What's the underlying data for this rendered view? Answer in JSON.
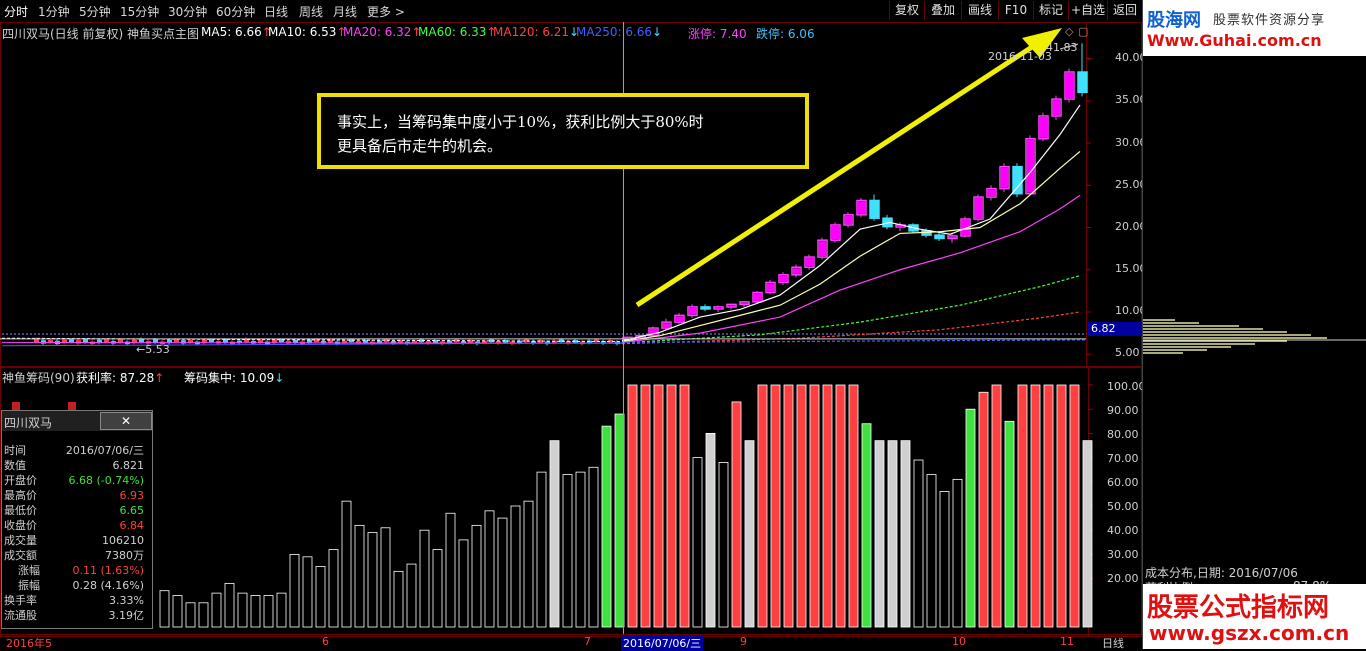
{
  "toolbar": {
    "timeframes": [
      "分时",
      "1分钟",
      "5分钟",
      "15分钟",
      "30分钟",
      "60分钟",
      "日线",
      "周线",
      "月线",
      "更多 >"
    ],
    "buttons": [
      "复权",
      "叠加",
      "画线",
      "F10",
      "标记",
      "+自选",
      "返回"
    ]
  },
  "main": {
    "stock_title": "四川双马(日线 前复权) 神鱼买点主图",
    "ma": [
      {
        "label": "MA5: 6.66",
        "arrow": "↑",
        "color": "#ffffff"
      },
      {
        "label": "MA10: 6.53",
        "arrow": "↑",
        "color": "#ffffff"
      },
      {
        "label": "MA20: 6.32",
        "arrow": "↑",
        "color": "#ff40ff"
      },
      {
        "label": "MA60: 6.33",
        "arrow": "↑",
        "color": "#40ff40"
      },
      {
        "label": "MA120: 6.21",
        "arrow": "↓",
        "color": "#ff4040"
      },
      {
        "label": "MA250: 6.66",
        "arrow": "↓",
        "color": "#4060ff"
      }
    ],
    "limit_up": "涨停: 7.40",
    "limit_down": "跌停: 6.06",
    "price_axis": [
      "40.00",
      "35.00",
      "30.00",
      "25.00",
      "20.00",
      "15.00",
      "10.00",
      "5.00"
    ],
    "current_price_tag": "6.82",
    "high_label": "2016-11-03",
    "high_value": "41.83",
    "low_label": "5.53",
    "annotation": [
      "事实上，当筹码集中度小于10%，获利比例大于80%时",
      "更具备后市走牛的机会。"
    ]
  },
  "indicator": {
    "title": "神鱼筹码(90)",
    "profit_label": "获利率: 87.28",
    "profit_arrow": "↑",
    "conc_label": "筹码集中: 10.09",
    "conc_arrow": "↓",
    "axis": [
      "100.00",
      "90.00",
      "80.00",
      "70.00",
      "60.00",
      "50.00",
      "40.00",
      "30.00",
      "20.00"
    ]
  },
  "popup": {
    "title": "四川双马",
    "close": "✕",
    "rows": [
      {
        "label": "时间",
        "value": "2016/07/06/三",
        "color": "#d0d0d0"
      },
      {
        "label": "数值",
        "value": "6.821",
        "color": "#d0d0d0"
      },
      {
        "label": "开盘价",
        "value": "6.68 (-0.74%)",
        "color": "#40e040"
      },
      {
        "label": "最高价",
        "value": "6.93",
        "color": "#ff4040"
      },
      {
        "label": "最低价",
        "value": "6.65",
        "color": "#40e040"
      },
      {
        "label": "收盘价",
        "value": "6.84",
        "color": "#ff4040"
      },
      {
        "label": "成交量",
        "value": "106210",
        "color": "#d0d0d0"
      },
      {
        "label": "成交额",
        "value": "7380万",
        "color": "#d0d0d0"
      },
      {
        "label": "涨幅",
        "value": "0.11 (1.63%)",
        "color": "#ff4040"
      },
      {
        "label": "振幅",
        "value": "0.28 (4.16%)",
        "color": "#d0d0d0"
      },
      {
        "label": "换手率",
        "value": "3.33%",
        "color": "#d0d0d0"
      },
      {
        "label": "流通股",
        "value": "3.19亿",
        "color": "#d0d0d0"
      }
    ]
  },
  "bottom_axis": {
    "labels": [
      "2016年5",
      "6",
      "7",
      "2016/07/06/三",
      "9",
      "10",
      "11"
    ],
    "period": "日线"
  },
  "right_panel": {
    "logo_main": "股海网",
    "logo_sub": "股票软件资源分享",
    "logo_url": "Www.Guhai.com.cn",
    "cost_title": "成本分布,日期: 2016/07/06",
    "profit_ratio": "获利比例:",
    "profit_value": "87.8%",
    "watermark_main": "股票公式指标网",
    "watermark_url": "www.gszx.com.cn"
  },
  "chart_data": {
    "type": "candlestick",
    "price_range": [
      4,
      43
    ],
    "candles": [
      [
        34,
        1,
        0.4
      ],
      [
        41,
        -1,
        0.4
      ],
      [
        48,
        1,
        0.3
      ],
      [
        55,
        -1,
        0.4
      ],
      [
        62,
        1,
        0.4
      ],
      [
        69,
        -1,
        0.3
      ],
      [
        76,
        1,
        0.4
      ],
      [
        83,
        -1,
        0.4
      ],
      [
        90,
        1,
        0.3
      ],
      [
        97,
        -1,
        0.4
      ],
      [
        104,
        1,
        0.3
      ],
      [
        111,
        -1,
        0.3
      ],
      [
        118,
        1,
        0.4
      ],
      [
        125,
        -1,
        0.3
      ],
      [
        132,
        1,
        0.4
      ],
      [
        139,
        -1,
        0.4
      ],
      [
        146,
        1,
        0.3
      ],
      [
        153,
        -1,
        0.4
      ],
      [
        160,
        1,
        0.3
      ],
      [
        167,
        -1,
        0.4
      ],
      [
        174,
        1,
        0.3
      ],
      [
        181,
        -1,
        0.4
      ],
      [
        188,
        1,
        0.3
      ],
      [
        195,
        -1,
        0.3
      ],
      [
        202,
        1,
        0.4
      ],
      [
        209,
        -1,
        0.3
      ],
      [
        216,
        1,
        0.3
      ],
      [
        223,
        -1,
        0.4
      ],
      [
        230,
        1,
        0.3
      ],
      [
        237,
        -1,
        0.3
      ],
      [
        244,
        1,
        0.4
      ],
      [
        251,
        -1,
        0.3
      ],
      [
        258,
        1,
        0.3
      ],
      [
        265,
        -1,
        0.3
      ],
      [
        272,
        1,
        0.4
      ],
      [
        279,
        -1,
        0.3
      ],
      [
        286,
        1,
        0.3
      ],
      [
        293,
        -1,
        0.3
      ],
      [
        300,
        1,
        0.3
      ],
      [
        307,
        -1,
        0.4
      ],
      [
        314,
        1,
        0.3
      ],
      [
        321,
        -1,
        0.3
      ],
      [
        328,
        1,
        0.3
      ],
      [
        335,
        -1,
        0.3
      ],
      [
        342,
        1,
        0.3
      ],
      [
        349,
        -1,
        0.3
      ],
      [
        356,
        1,
        0.3
      ],
      [
        363,
        -1,
        0.3
      ],
      [
        370,
        1,
        0.3
      ],
      [
        377,
        -1,
        0.3
      ],
      [
        384,
        1,
        0.3
      ],
      [
        391,
        -1,
        0.3
      ],
      [
        398,
        1,
        0.3
      ],
      [
        405,
        -1,
        0.3
      ],
      [
        412,
        1,
        0.3
      ],
      [
        419,
        -1,
        0.3
      ],
      [
        426,
        1,
        0.3
      ],
      [
        433,
        -1,
        0.3
      ],
      [
        440,
        1,
        0.3
      ],
      [
        447,
        -1,
        0.3
      ],
      [
        454,
        1,
        0.3
      ],
      [
        461,
        -1,
        0.3
      ],
      [
        468,
        1,
        0.3
      ],
      [
        475,
        -1,
        0.3
      ],
      [
        482,
        1,
        0.3
      ],
      [
        489,
        -1,
        0.3
      ],
      [
        496,
        1,
        0.3
      ],
      [
        503,
        -1,
        0.3
      ],
      [
        510,
        1,
        0.3
      ],
      [
        517,
        -1,
        0.3
      ],
      [
        524,
        1,
        0.3
      ],
      [
        531,
        -1,
        0.3
      ],
      [
        538,
        1,
        0.3
      ],
      [
        545,
        -1,
        0.3
      ],
      [
        552,
        1,
        0.3
      ],
      [
        559,
        -1,
        0.3
      ],
      [
        566,
        1,
        0.3
      ],
      [
        573,
        -1,
        0.3
      ],
      [
        580,
        1,
        0.3
      ],
      [
        587,
        -1,
        0.3
      ],
      [
        594,
        1,
        0.3
      ],
      [
        601,
        -1,
        0.3
      ],
      [
        608,
        1,
        0.3
      ],
      [
        615,
        -1,
        0.3
      ]
    ],
    "series_main": [
      {
        "name": "MA5",
        "color": "#ffffff"
      },
      {
        "name": "MA10",
        "color": "#ffffb0"
      },
      {
        "name": "MA20",
        "color": "#ff40ff"
      },
      {
        "name": "MA60",
        "color": "#40ff40"
      },
      {
        "name": "MA120",
        "color": "#ff4040"
      },
      {
        "name": "MA250",
        "color": "#4060ff"
      }
    ],
    "rally": [
      [
        623,
        6.8,
        7.1,
        6.6,
        7.0
      ],
      [
        636,
        7.0,
        7.3,
        6.9,
        7.2
      ],
      [
        649,
        7.2,
        8.3,
        7.1,
        8.1
      ],
      [
        662,
        8.1,
        9.2,
        7.9,
        8.8
      ],
      [
        675,
        8.8,
        9.9,
        8.6,
        9.6
      ],
      [
        688,
        9.6,
        10.9,
        9.3,
        10.6
      ],
      [
        701,
        10.6,
        10.9,
        10.1,
        10.4
      ],
      [
        714,
        10.4,
        10.8,
        10.0,
        10.6
      ],
      [
        727,
        10.6,
        11.0,
        10.3,
        10.9
      ],
      [
        740,
        10.9,
        11.3,
        10.6,
        11.2
      ],
      [
        753,
        11.2,
        12.5,
        11.0,
        12.3
      ],
      [
        766,
        12.3,
        13.8,
        12.1,
        13.5
      ],
      [
        779,
        13.5,
        14.7,
        13.2,
        14.4
      ],
      [
        792,
        14.4,
        15.6,
        14.1,
        15.3
      ],
      [
        805,
        15.3,
        16.8,
        15.0,
        16.5
      ],
      [
        818,
        16.5,
        18.8,
        16.2,
        18.5
      ],
      [
        831,
        18.5,
        20.6,
        18.2,
        20.3
      ],
      [
        844,
        20.3,
        21.8,
        20.0,
        21.5
      ],
      [
        857,
        21.5,
        23.5,
        21.2,
        23.2
      ],
      [
        870,
        23.2,
        23.9,
        20.8,
        21.1
      ],
      [
        883,
        21.1,
        21.5,
        19.8,
        20.1
      ],
      [
        896,
        20.1,
        20.6,
        19.6,
        20.3
      ],
      [
        909,
        20.3,
        20.5,
        19.4,
        19.6
      ],
      [
        922,
        19.6,
        19.9,
        18.8,
        19.1
      ],
      [
        935,
        19.1,
        19.6,
        18.4,
        18.7
      ],
      [
        948,
        18.7,
        19.4,
        18.2,
        19.0
      ],
      [
        961,
        19.0,
        21.3,
        18.8,
        21.0
      ],
      [
        974,
        21.0,
        23.9,
        20.7,
        23.6
      ],
      [
        987,
        23.6,
        25.0,
        23.2,
        24.6
      ],
      [
        1000,
        24.6,
        27.6,
        24.2,
        27.2
      ],
      [
        1013,
        27.2,
        27.6,
        23.6,
        24.0
      ],
      [
        1026,
        24.0,
        30.9,
        23.8,
        30.5
      ],
      [
        1039,
        30.5,
        33.6,
        30.2,
        33.2
      ],
      [
        1052,
        33.2,
        35.6,
        32.7,
        35.2
      ],
      [
        1065,
        35.2,
        38.8,
        34.8,
        38.4
      ],
      [
        1078,
        38.4,
        41.8,
        35.5,
        36.0
      ]
    ],
    "indicator_bars": [
      [
        160,
        15,
        "#ffffff"
      ],
      [
        173,
        13,
        "#ffffff"
      ],
      [
        186,
        10,
        "#ffffff"
      ],
      [
        199,
        10,
        "#ffffff"
      ],
      [
        212,
        14,
        "#ffffff"
      ],
      [
        225,
        18,
        "#ffffff"
      ],
      [
        238,
        14,
        "#ffffff"
      ],
      [
        251,
        13,
        "#ffffff"
      ],
      [
        264,
        13,
        "#ffffff"
      ],
      [
        277,
        14,
        "#ffffff"
      ],
      [
        290,
        30,
        "#ffffff"
      ],
      [
        303,
        29,
        "#ffffff"
      ],
      [
        316,
        25,
        "#ffffff"
      ],
      [
        329,
        32,
        "#ffffff"
      ],
      [
        342,
        52,
        "#ffffff"
      ],
      [
        355,
        42,
        "#ffffff"
      ],
      [
        368,
        39,
        "#ffffff"
      ],
      [
        381,
        41,
        "#ffffff"
      ],
      [
        394,
        23,
        "#ffffff"
      ],
      [
        407,
        26,
        "#ffffff"
      ],
      [
        420,
        40,
        "#ffffff"
      ],
      [
        433,
        32,
        "#ffffff"
      ],
      [
        446,
        47,
        "#ffffff"
      ],
      [
        459,
        36,
        "#ffffff"
      ],
      [
        472,
        42,
        "#ffffff"
      ],
      [
        485,
        48,
        "#ffffff"
      ],
      [
        498,
        45,
        "#ffffff"
      ],
      [
        511,
        50,
        "#ffffff"
      ],
      [
        524,
        52,
        "#ffffff"
      ],
      [
        537,
        64,
        "#ffffff"
      ],
      [
        550,
        77,
        "#d0d0d0"
      ],
      [
        563,
        63,
        "#ffffff"
      ],
      [
        576,
        64,
        "#ffffff"
      ],
      [
        589,
        66,
        "#ffffff"
      ],
      [
        602,
        83,
        "#40e040"
      ],
      [
        615,
        88,
        "#40e040"
      ],
      [
        628,
        100,
        "#ff4040"
      ],
      [
        641,
        100,
        "#ff4040"
      ],
      [
        654,
        100,
        "#ff4040"
      ],
      [
        667,
        100,
        "#ff4040"
      ],
      [
        680,
        100,
        "#ff4040"
      ],
      [
        693,
        70,
        "#ffffff"
      ],
      [
        706,
        80,
        "#d0d0d0"
      ],
      [
        719,
        68,
        "#ffffff"
      ],
      [
        732,
        93,
        "#ff4040"
      ],
      [
        745,
        77,
        "#d0d0d0"
      ],
      [
        758,
        100,
        "#ff4040"
      ],
      [
        771,
        100,
        "#ff4040"
      ],
      [
        784,
        100,
        "#ff4040"
      ],
      [
        797,
        100,
        "#ff4040"
      ],
      [
        810,
        100,
        "#ff4040"
      ],
      [
        823,
        100,
        "#ff4040"
      ],
      [
        836,
        100,
        "#ff4040"
      ],
      [
        849,
        100,
        "#ff4040"
      ],
      [
        862,
        84,
        "#40e040"
      ],
      [
        875,
        77,
        "#d0d0d0"
      ],
      [
        888,
        77,
        "#d0d0d0"
      ],
      [
        901,
        77,
        "#d0d0d0"
      ],
      [
        914,
        69,
        "#ffffff"
      ],
      [
        927,
        63,
        "#ffffff"
      ],
      [
        940,
        56,
        "#ffffff"
      ],
      [
        953,
        61,
        "#ffffff"
      ],
      [
        966,
        90,
        "#40e040"
      ],
      [
        979,
        97,
        "#ff4040"
      ],
      [
        992,
        100,
        "#ff4040"
      ],
      [
        1005,
        85,
        "#40e040"
      ],
      [
        1018,
        100,
        "#ff4040"
      ],
      [
        1031,
        100,
        "#ff4040"
      ],
      [
        1044,
        100,
        "#ff4040"
      ],
      [
        1057,
        100,
        "#ff4040"
      ],
      [
        1070,
        100,
        "#ff4040"
      ],
      [
        1083,
        77,
        "#d0d0d0"
      ]
    ],
    "cost_distribution": [
      [
        320,
        40
      ],
      [
        323,
        70
      ],
      [
        326,
        120
      ],
      [
        329,
        150
      ],
      [
        332,
        180
      ],
      [
        335,
        210
      ],
      [
        338,
        230
      ],
      [
        341,
        180
      ],
      [
        344,
        140
      ],
      [
        347,
        110
      ],
      [
        350,
        80
      ],
      [
        353,
        50
      ]
    ]
  }
}
